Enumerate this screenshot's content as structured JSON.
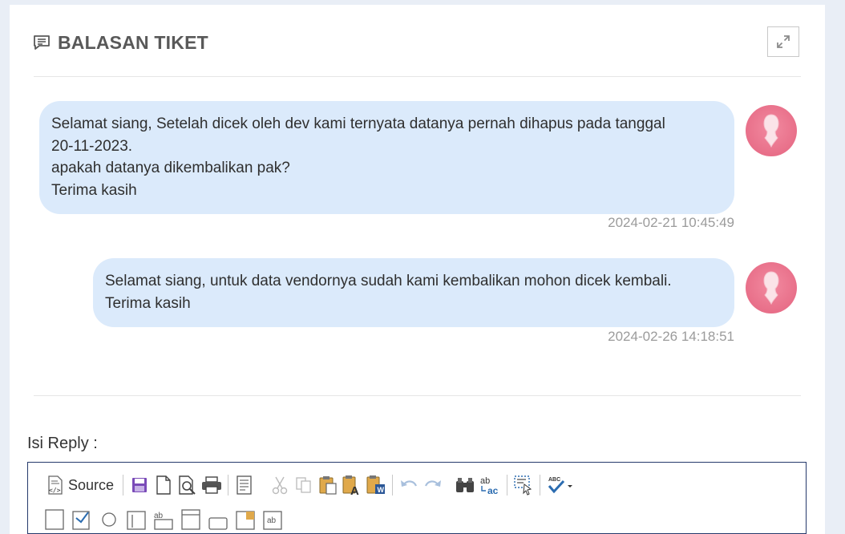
{
  "panel": {
    "title": "BALASAN TIKET"
  },
  "messages": [
    {
      "lines": [
        "Selamat siang, Setelah dicek oleh dev kami ternyata datanya pernah dihapus pada tanggal",
        "20-11-2023.",
        "apakah datanya dikembalikan pak?",
        "Terima kasih"
      ],
      "timestamp": "2024-02-21 10:45:49"
    },
    {
      "lines": [
        "Selamat siang, untuk data vendornya sudah kami kembalikan mohon dicek kembali.",
        "Terima kasih"
      ],
      "timestamp": "2024-02-26 14:18:51"
    }
  ],
  "reply": {
    "label": "Isi Reply :"
  },
  "editor": {
    "source_label": "Source",
    "toolbar_icons": [
      "source-icon",
      "save-icon",
      "new-page-icon",
      "preview-icon",
      "print-icon",
      "templates-icon",
      "cut-icon",
      "copy-icon",
      "paste-icon",
      "paste-text-icon",
      "paste-word-icon",
      "undo-icon",
      "redo-icon",
      "find-icon",
      "replace-icon",
      "select-all-icon",
      "spellcheck-icon"
    ]
  },
  "colors": {
    "bubble": "#dbeafb",
    "avatar": "#e86f89",
    "accent_purple": "#7a4bb8"
  }
}
